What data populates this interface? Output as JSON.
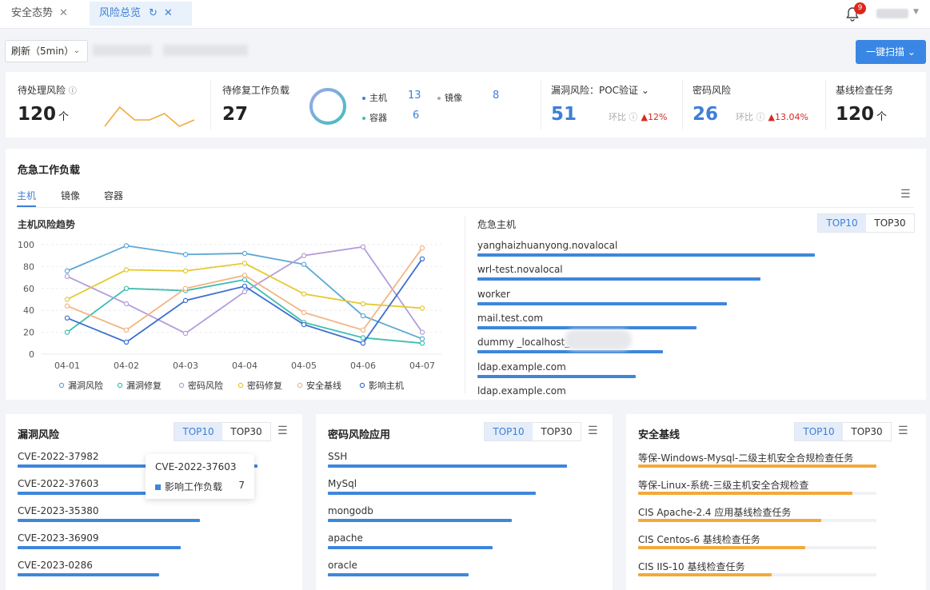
{
  "tabs": [
    {
      "label": "安全态势"
    },
    {
      "label": "风险总览"
    }
  ],
  "notifications": {
    "count": "9"
  },
  "toolbar": {
    "refresh_label": "刷新（5min）",
    "scan_label": "一键扫描"
  },
  "stats": {
    "pending_risk": {
      "label": "待处理风险",
      "value": "120",
      "unit": "个",
      "trend": [
        40,
        55,
        45,
        45,
        50,
        40,
        45
      ]
    },
    "workloads": {
      "label": "待修复工作负载",
      "value": "27",
      "host_label": "主机",
      "host_value": "13",
      "image_label": "镜像",
      "image_value": "8",
      "container_label": "容器",
      "container_value": "6"
    },
    "vuln": {
      "label": "漏洞风险：POC验证",
      "value": "51",
      "cmp_label": "环比",
      "cmp_value": "12%"
    },
    "password": {
      "label": "密码风险",
      "value": "26",
      "cmp_label": "环比",
      "cmp_value": "13.04%"
    },
    "baseline": {
      "label": "基线检查任务",
      "value": "120",
      "unit": "个"
    }
  },
  "critical": {
    "title": "危急工作负载",
    "tabs": [
      "主机",
      "镜像",
      "容器"
    ],
    "trend_title": "主机风险趋势",
    "hosts_title": "危急主机",
    "top10": "TOP10",
    "top30": "TOP30",
    "hosts": [
      {
        "name": "yanghaizhuanyong.novalocal",
        "value": 100
      },
      {
        "name": "wrl-test.novalocal",
        "value": 84
      },
      {
        "name": "worker",
        "value": 74
      },
      {
        "name": "mail.test.com",
        "value": 65
      },
      {
        "name": "dummy _localhost_",
        "value": 55
      },
      {
        "name": "ldap.example.com",
        "value": 47
      },
      {
        "name": "ldap.example.com",
        "value": 40
      }
    ]
  },
  "chart_data": {
    "type": "line",
    "x": [
      "04-01",
      "04-02",
      "04-03",
      "04-04",
      "04-05",
      "04-06",
      "04-07"
    ],
    "ylim": [
      0,
      100
    ],
    "yticks": [
      "100",
      "80",
      "60",
      "40",
      "20",
      "0"
    ],
    "series": [
      {
        "name": "漏洞风险",
        "color": "#5aa9d6",
        "values": [
          76,
          99,
          91,
          92,
          82,
          35,
          14
        ]
      },
      {
        "name": "漏洞修复",
        "color": "#3fbfb0",
        "values": [
          20,
          60,
          58,
          68,
          29,
          15,
          10
        ]
      },
      {
        "name": "密码风险",
        "color": "#b39ddb",
        "values": [
          71,
          46,
          19,
          57,
          90,
          98,
          20
        ]
      },
      {
        "name": "密码修复",
        "color": "#e6c82e",
        "values": [
          50,
          77,
          76,
          83,
          55,
          46,
          42
        ]
      },
      {
        "name": "安全基线",
        "color": "#f3b583",
        "values": [
          44,
          22,
          60,
          72,
          38,
          22,
          97
        ]
      },
      {
        "name": "影响主机",
        "color": "#3c6fd0",
        "values": [
          33,
          11,
          49,
          62,
          27,
          10,
          87
        ]
      }
    ]
  },
  "vuln_panel": {
    "title": "漏洞风险",
    "top10": "TOP10",
    "top30": "TOP30",
    "items": [
      {
        "name": "CVE-2022-37982",
        "value": 100
      },
      {
        "name": "CVE-2022-37603",
        "value": 80
      },
      {
        "name": "CVE-2023-35380",
        "value": 76
      },
      {
        "name": "CVE-2023-36909",
        "value": 68
      },
      {
        "name": "CVE-2023-0286",
        "value": 59
      }
    ],
    "tooltip": {
      "title": "CVE-2022-37603",
      "label": "影响工作负载",
      "value": "7"
    }
  },
  "pwd_panel": {
    "title": "密码风险应用",
    "top10": "TOP10",
    "top30": "TOP30",
    "items": [
      {
        "name": "SSH",
        "value": 100
      },
      {
        "name": "MySql",
        "value": 87
      },
      {
        "name": "mongodb",
        "value": 77
      },
      {
        "name": "apache",
        "value": 69
      },
      {
        "name": "oracle",
        "value": 59
      }
    ]
  },
  "base_panel": {
    "title": "安全基线",
    "top10": "TOP10",
    "top30": "TOP30",
    "items": [
      {
        "name": "等保-Windows-Mysql-二级主机安全合规检查任务",
        "value": 100
      },
      {
        "name": "等保-Linux-系统-三级主机安全合规检查",
        "value": 90
      },
      {
        "name": "CIS Apache-2.4 应用基线检查任务",
        "value": 77
      },
      {
        "name": "CIS Centos-6 基线检查任务",
        "value": 70
      },
      {
        "name": "CIS IIS-10 基线检查任务",
        "value": 56
      }
    ]
  }
}
